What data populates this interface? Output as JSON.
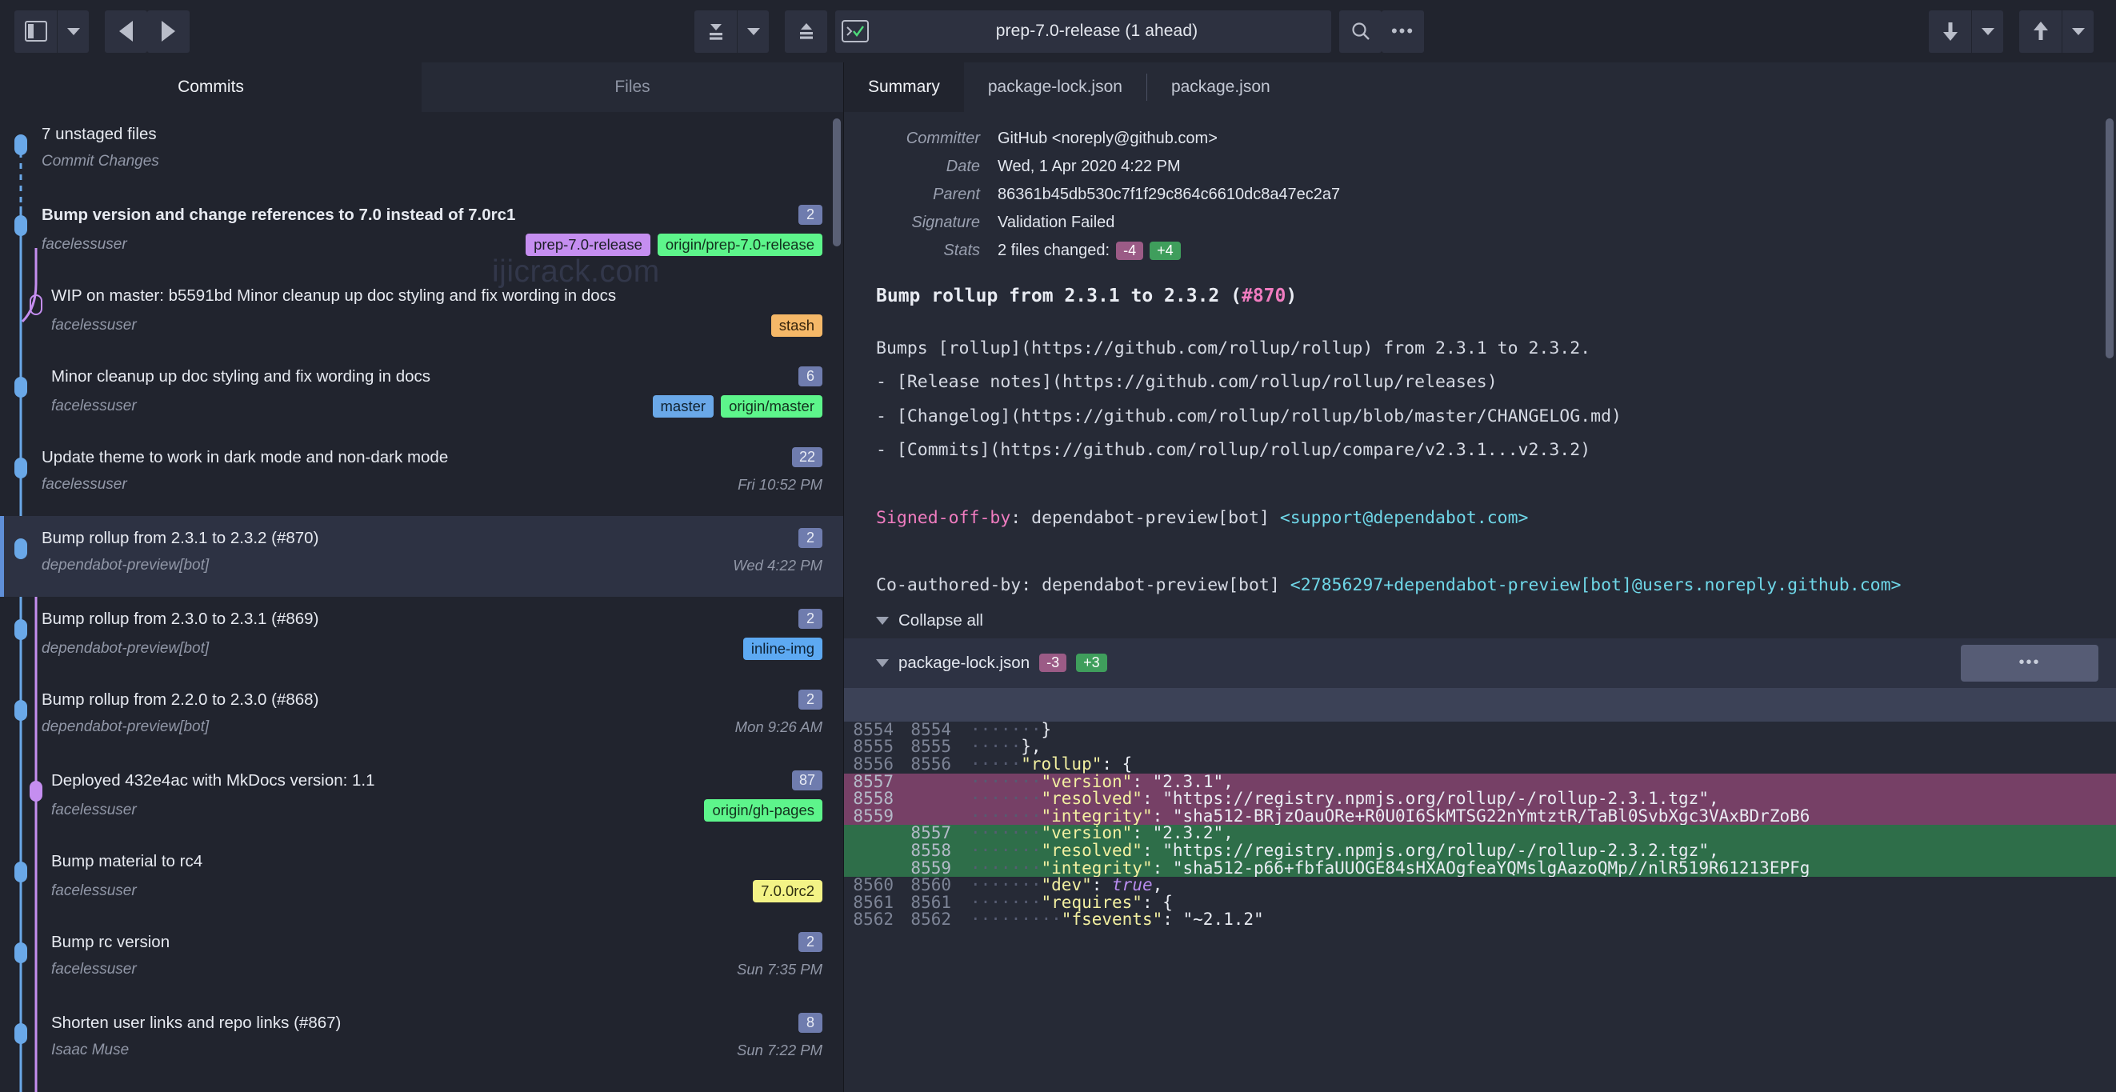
{
  "toolbar": {
    "sidebar_toggle_icon": "panel-icon",
    "sidebar_dropdown_icon": "chevron-down-icon",
    "back_icon": "triangle-left-icon",
    "forward_icon": "triangle-right-icon",
    "pull_icon": "pull-down-icon",
    "pull_dropdown_icon": "chevron-down-icon",
    "push_icon": "push-up-icon",
    "terminal_icon": "terminal-check-icon",
    "branch_value": "prep-7.0-release (1 ahead)",
    "branch_placeholder": "branch",
    "search_icon": "search-icon",
    "more_label": "•••",
    "fetch_icon": "arrow-down-icon",
    "fetch_dropdown_icon": "chevron-down-icon",
    "push_toolbar_icon": "arrow-up-icon",
    "push_dropdown_icon": "chevron-down-icon"
  },
  "left": {
    "tabs": [
      {
        "label": "Commits",
        "active": true
      },
      {
        "label": "Files",
        "active": false
      }
    ],
    "watermark": "ijicrack.com",
    "commits": [
      {
        "title": "7 unstaged files",
        "author": "Commit Changes",
        "date": "",
        "count": "",
        "refs": [],
        "bold": false,
        "selected": false,
        "working": true
      },
      {
        "title": "Bump version and change references to 7.0 instead of 7.0rc1",
        "author": "facelessuser",
        "date": "",
        "count": "2",
        "refs": [
          {
            "label": "prep-7.0-release",
            "kind": "local"
          },
          {
            "label": "origin/prep-7.0-release",
            "kind": "remote"
          }
        ],
        "bold": true,
        "selected": false
      },
      {
        "title": "WIP on master: b5591bd Minor cleanup up doc styling and fix wording in docs",
        "author": "facelessuser",
        "date": "",
        "count": "",
        "refs": [
          {
            "label": "stash",
            "kind": "stash"
          }
        ],
        "bold": false,
        "selected": false
      },
      {
        "title": "Minor cleanup up doc styling and fix wording in docs",
        "author": "facelessuser",
        "date": "",
        "count": "6",
        "refs": [
          {
            "label": "master",
            "kind": "masterl"
          },
          {
            "label": "origin/master",
            "kind": "remote"
          }
        ],
        "bold": false,
        "selected": false
      },
      {
        "title": "Update theme to work in dark mode and non-dark mode",
        "author": "facelessuser",
        "date": "Fri 10:52 PM",
        "count": "22",
        "refs": [],
        "bold": false,
        "selected": false
      },
      {
        "title": "Bump rollup from 2.3.1 to 2.3.2 (#870)",
        "author": "dependabot-preview[bot]",
        "date": "Wed 4:22 PM",
        "count": "2",
        "refs": [],
        "bold": false,
        "selected": true
      },
      {
        "title": "Bump rollup from 2.3.0 to 2.3.1 (#869)",
        "author": "dependabot-preview[bot]",
        "date": "",
        "count": "2",
        "refs": [
          {
            "label": "inline-img",
            "kind": "bluel"
          }
        ],
        "bold": false,
        "selected": false
      },
      {
        "title": "Bump rollup from 2.2.0 to 2.3.0 (#868)",
        "author": "dependabot-preview[bot]",
        "date": "Mon 9:26 AM",
        "count": "2",
        "refs": [],
        "bold": false,
        "selected": false
      },
      {
        "title": "Deployed 432e4ac with MkDocs version: 1.1",
        "author": "facelessuser",
        "date": "",
        "count": "87",
        "refs": [
          {
            "label": "origin/gh-pages",
            "kind": "remote"
          }
        ],
        "bold": false,
        "selected": false
      },
      {
        "title": "Bump material to rc4",
        "author": "facelessuser",
        "date": "",
        "count": "",
        "refs": [
          {
            "label": "7.0.0rc2",
            "kind": "tag"
          }
        ],
        "bold": false,
        "selected": false
      },
      {
        "title": "Bump rc version",
        "author": "facelessuser",
        "date": "Sun 7:35 PM",
        "count": "2",
        "refs": [],
        "bold": false,
        "selected": false
      },
      {
        "title": "Shorten user links and repo links (#867)",
        "author": "Isaac Muse",
        "date": "Sun 7:22 PM",
        "count": "8",
        "refs": [],
        "bold": false,
        "selected": false
      }
    ]
  },
  "right": {
    "tabs": [
      {
        "label": "Summary",
        "active": true
      },
      {
        "label": "package-lock.json",
        "active": false
      },
      {
        "label": "package.json",
        "active": false
      }
    ],
    "meta": [
      {
        "label": "Committer",
        "value": "GitHub <noreply@github.com>"
      },
      {
        "label": "Date",
        "value": "Wed, 1 Apr 2020 4:22 PM"
      },
      {
        "label": "Parent",
        "value": "86361b45db530c7f1f29c864c6610dc8a47ec2a7"
      },
      {
        "label": "Signature",
        "value": "Validation Failed"
      }
    ],
    "stats": {
      "label": "Stats",
      "text": "2 files changed:",
      "deletions": "-4",
      "additions": "+4"
    },
    "message": {
      "title_prefix": "Bump rollup from 2.3.1 to 2.3.2 (",
      "title_issue": "#870",
      "title_suffix": ")",
      "body_line_1": "Bumps [rollup](https://github.com/rollup/rollup) from 2.3.1 to 2.3.2.",
      "body_line_2": "- [Release notes](https://github.com/rollup/rollup/releases)",
      "body_line_3": "- [Changelog](https://github.com/rollup/rollup/blob/master/CHANGELOG.md)",
      "body_line_4": "- [Commits](https://github.com/rollup/rollup/compare/v2.3.1...v2.3.2)",
      "signed_key": "Signed-off-by",
      "signed_rest": ": dependabot-preview[bot] ",
      "signed_email": "<support@dependabot.com>",
      "coauthor_text": "Co-authored-by: dependabot-preview[bot] ",
      "coauthor_email": "<27856297+dependabot-preview[bot]@users.noreply.github.com>"
    },
    "collapse_all_label": "Collapse all",
    "file": {
      "name": "package-lock.json",
      "deletions": "-3",
      "additions": "+3",
      "more_label": "•••"
    },
    "diff": [
      {
        "old": "8554",
        "new": "8554",
        "type": "ctx",
        "ws": "·······",
        "code_key": "",
        "code": "}"
      },
      {
        "old": "8555",
        "new": "8555",
        "type": "ctx",
        "ws": "·····",
        "code_key": "",
        "code": "},"
      },
      {
        "old": "8556",
        "new": "8556",
        "type": "ctx",
        "ws": "·····",
        "code_key": "\"rollup\"",
        "code": ": {"
      },
      {
        "old": "8557",
        "new": "",
        "type": "del",
        "ws": "·······",
        "code_key": "\"version\"",
        "code": ": \"2.3.1\","
      },
      {
        "old": "8558",
        "new": "",
        "type": "del",
        "ws": "·······",
        "code_key": "\"resolved\"",
        "code": ": \"https://registry.npmjs.org/rollup/-/rollup-2.3.1.tgz\","
      },
      {
        "old": "8559",
        "new": "",
        "type": "del",
        "ws": "·······",
        "code_key": "\"integrity\"",
        "code": ": \"sha512-BRjzOauORe+R0U0I6SkMTSG22nYmtztR/TaBl0SvbXgc3VAxBDrZoB6"
      },
      {
        "old": "",
        "new": "8557",
        "type": "add",
        "ws": "·······",
        "code_key": "\"version\"",
        "code": ": \"2.3.2\","
      },
      {
        "old": "",
        "new": "8558",
        "type": "add",
        "ws": "·······",
        "code_key": "\"resolved\"",
        "code": ": \"https://registry.npmjs.org/rollup/-/rollup-2.3.2.tgz\","
      },
      {
        "old": "",
        "new": "8559",
        "type": "add",
        "ws": "·······",
        "code_key": "\"integrity\"",
        "code": ": \"sha512-p66+fbfaUUOGE84sHXAOgfeaYQMslgAazoQMp//nlR519R61213EPFg"
      },
      {
        "old": "8560",
        "new": "8560",
        "type": "ctx",
        "ws": "·······",
        "code_key": "\"dev\"",
        "code": ": ",
        "bool": "true",
        "tail": ","
      },
      {
        "old": "8561",
        "new": "8561",
        "type": "ctx",
        "ws": "·······",
        "code_key": "\"requires\"",
        "code": ": {"
      },
      {
        "old": "8562",
        "new": "8562",
        "type": "ctx",
        "ws": "·········",
        "code_key": "\"fsevents\"",
        "code": ": \"~2.1.2\""
      }
    ]
  }
}
